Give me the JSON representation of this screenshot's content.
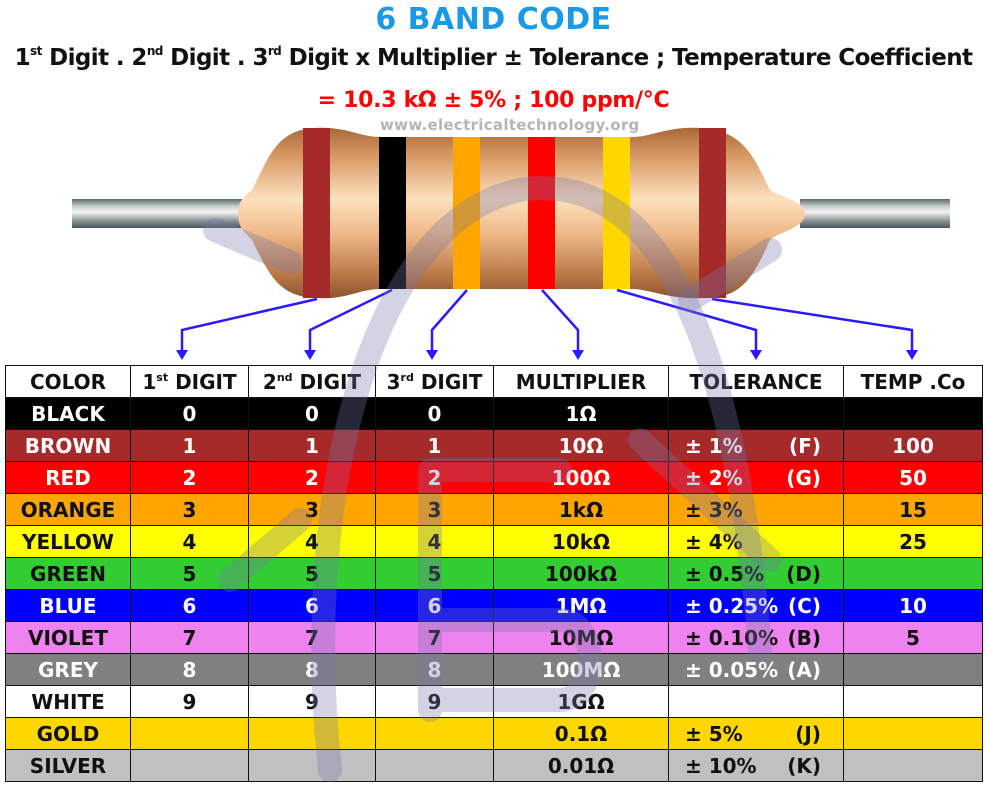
{
  "header": {
    "title": "6 BAND CODE",
    "formula": {
      "d1_num": "1",
      "d1_sup": "st",
      "d1_word": " Digit",
      "sep1": " . ",
      "d2_num": "2",
      "d2_sup": "nd",
      "d2_word": " Digit",
      "sep2": " . ",
      "d3_num": "3",
      "d3_sup": "rd",
      "d3_word": " Digit",
      "mult": " x Multiplier ",
      "tol": " ± Tolerance",
      "temp": " ; Temperature Coefficient"
    },
    "result": "= 10.3 kΩ   ± 5%  ;  100 ppm/°C",
    "watermark": "www.electricaltechnology.org"
  },
  "resistor": {
    "bands": [
      {
        "name": "brown",
        "role": "1st digit",
        "color": "#a52a2a"
      },
      {
        "name": "black",
        "role": "2nd digit",
        "color": "#000000"
      },
      {
        "name": "orange",
        "role": "3rd digit",
        "color": "#ffa500"
      },
      {
        "name": "red",
        "role": "multiplier",
        "color": "#ff0000"
      },
      {
        "name": "gold",
        "role": "tolerance",
        "color": "#ffd700"
      },
      {
        "name": "brown",
        "role": "temperature coefficient",
        "color": "#a52a2a"
      }
    ]
  },
  "table": {
    "headers": [
      {
        "num": "",
        "sup": "",
        "text": "COLOR"
      },
      {
        "num": "1",
        "sup": "st",
        "text": " DIGIT"
      },
      {
        "num": "2",
        "sup": "nd",
        "text": " DIGIT"
      },
      {
        "num": "3",
        "sup": "rd",
        "text": " DIGIT"
      },
      {
        "num": "",
        "sup": "",
        "text": "MULTIPLIER"
      },
      {
        "num": "",
        "sup": "",
        "text": "TOLERANCE"
      },
      {
        "num": "",
        "sup": "",
        "text": "TEMP .Co"
      }
    ],
    "rows": [
      {
        "color": "BLACK",
        "bg": "#000000",
        "fg": "#ffffff",
        "d1": "0",
        "d2": "0",
        "d3": "0",
        "mult": "1Ω",
        "tol": "",
        "tol_code": "",
        "temp": ""
      },
      {
        "color": "BROWN",
        "bg": "#a52a2a",
        "fg": "#ffffff",
        "d1": "1",
        "d2": "1",
        "d3": "1",
        "mult": "10Ω",
        "tol": "± 1%",
        "tol_code": "(F)",
        "temp": "100"
      },
      {
        "color": "RED",
        "bg": "#ff0000",
        "fg": "#ffffff",
        "d1": "2",
        "d2": "2",
        "d3": "2",
        "mult": "100Ω",
        "tol": "± 2%",
        "tol_code": "(G)",
        "temp": "50"
      },
      {
        "color": "ORANGE",
        "bg": "#ffa500",
        "fg": "#111111",
        "d1": "3",
        "d2": "3",
        "d3": "3",
        "mult": "1kΩ",
        "tol": "± 3%",
        "tol_code": "",
        "temp": "15"
      },
      {
        "color": "YELLOW",
        "bg": "#ffff00",
        "fg": "#111111",
        "d1": "4",
        "d2": "4",
        "d3": "4",
        "mult": "10kΩ",
        "tol": "± 4%",
        "tol_code": "",
        "temp": "25"
      },
      {
        "color": "GREEN",
        "bg": "#32cd32",
        "fg": "#111111",
        "d1": "5",
        "d2": "5",
        "d3": "5",
        "mult": "100kΩ",
        "tol": "± 0.5%",
        "tol_code": "(D)",
        "temp": ""
      },
      {
        "color": "BLUE",
        "bg": "#0000ff",
        "fg": "#ffffff",
        "d1": "6",
        "d2": "6",
        "d3": "6",
        "mult": "1MΩ",
        "tol": "± 0.25%",
        "tol_code": "(C)",
        "temp": "10"
      },
      {
        "color": "VIOLET",
        "bg": "#ee82ee",
        "fg": "#111111",
        "d1": "7",
        "d2": "7",
        "d3": "7",
        "mult": "10MΩ",
        "tol": "± 0.10%",
        "tol_code": "(B)",
        "temp": "5"
      },
      {
        "color": "GREY",
        "bg": "#808080",
        "fg": "#ffffff",
        "d1": "8",
        "d2": "8",
        "d3": "8",
        "mult": "100MΩ",
        "tol": "± 0.05%",
        "tol_code": "(A)",
        "temp": ""
      },
      {
        "color": "WHITE",
        "bg": "#ffffff",
        "fg": "#111111",
        "d1": "9",
        "d2": "9",
        "d3": "9",
        "mult": "1GΩ",
        "tol": "",
        "tol_code": "",
        "temp": ""
      },
      {
        "color": "GOLD",
        "bg": "#ffd700",
        "fg": "#111111",
        "d1": "",
        "d2": "",
        "d3": "",
        "mult": "0.1Ω",
        "tol": "± 5%",
        "tol_code": "(J)",
        "temp": ""
      },
      {
        "color": "SILVER",
        "bg": "#c0c0c0",
        "fg": "#111111",
        "d1": "",
        "d2": "",
        "d3": "",
        "mult": "0.01Ω",
        "tol": "± 10%",
        "tol_code": "(K)",
        "temp": ""
      }
    ]
  },
  "colors": {
    "title": "#1a9ae6",
    "result": "#ff0000",
    "arrow": "#2a1aff",
    "body": "#dba06a",
    "watermark_logo": "#8888bb"
  }
}
